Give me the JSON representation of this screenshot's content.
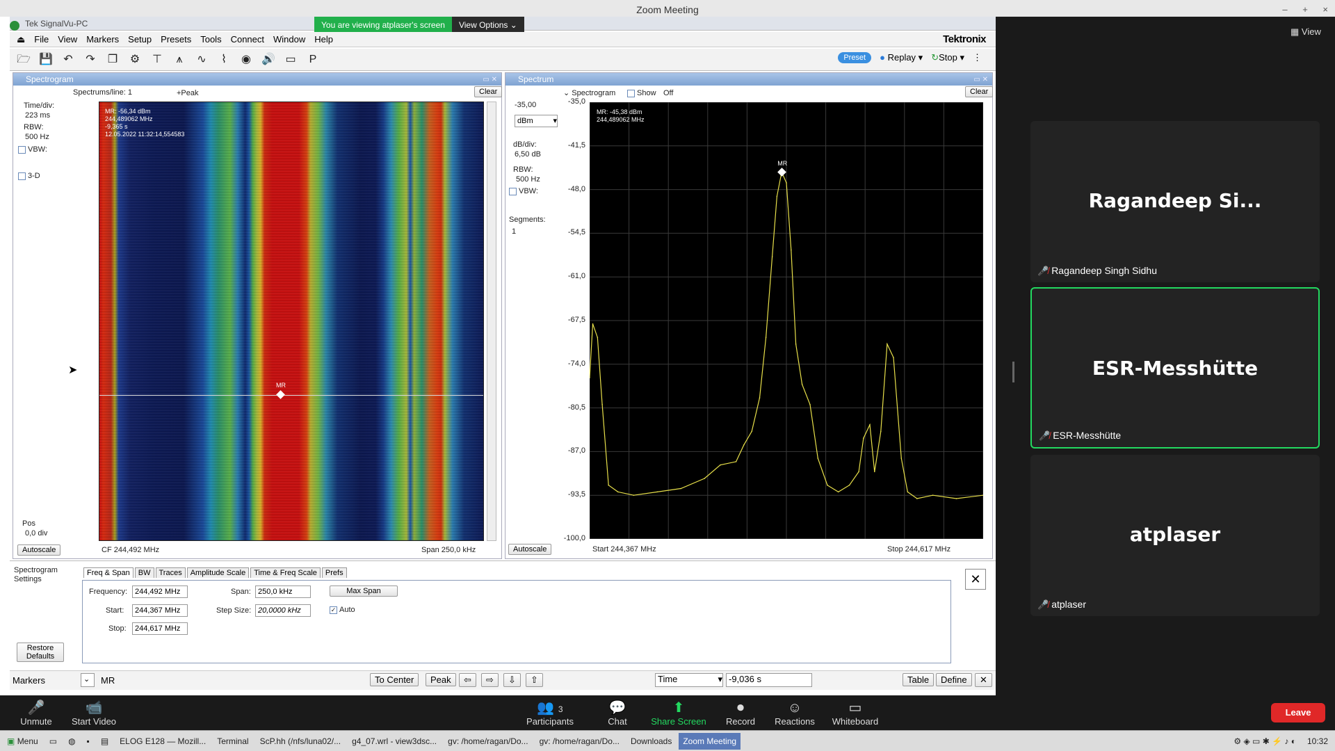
{
  "zoom": {
    "window_title": "Zoom Meeting",
    "win_controls": [
      "–",
      "+",
      "×"
    ],
    "view_label": "View",
    "participants": [
      {
        "display": "Ragandeep Si...",
        "full": "Ragandeep Singh Sidhu",
        "active": false
      },
      {
        "display": "ESR-Messhütte",
        "full": "ESR-Messhütte",
        "active": true
      },
      {
        "display": "atplaser",
        "full": "atplaser",
        "active": false
      }
    ],
    "controls": {
      "unmute": "Unmute",
      "start_video": "Start Video",
      "participants": "Participants",
      "participants_count": "3",
      "chat": "Chat",
      "share_screen": "Share Screen",
      "record": "Record",
      "reactions": "Reactions",
      "whiteboard": "Whiteboard",
      "leave": "Leave"
    }
  },
  "share_banner": {
    "text": "You are viewing atplaser's screen",
    "view_options": "View Options"
  },
  "signalvu": {
    "title": "Tek SignalVu-PC",
    "brand": "Tektronix",
    "menu": [
      "File",
      "View",
      "Markers",
      "Setup",
      "Presets",
      "Tools",
      "Connect",
      "Window",
      "Help"
    ],
    "toolbar_right": {
      "preset": "Preset",
      "replay": "Replay",
      "stop": "Stop"
    }
  },
  "spectrogram": {
    "title": "Spectrogram",
    "spectrums_per_line_label": "Spectrums/line:",
    "spectrums_per_line_value": "1",
    "detector": "+Peak",
    "clear": "Clear",
    "time_div_label": "Time/div:",
    "time_div_value": "223 ms",
    "rbw_label": "RBW:",
    "rbw_value": "500 Hz",
    "vbw_label": "VBW:",
    "threed_label": "3-D",
    "pos_label": "Pos",
    "pos_value": "0,0 div",
    "autoscale": "Autoscale",
    "marker_line1": "MR: -56,34 dBm",
    "marker_line2": "244,489062 MHz",
    "marker_line3": "-9,365 s",
    "marker_line4": "12.05.2022 11:32:14,554583",
    "marker_tag": "MR",
    "cf": "CF  244,492 MHz",
    "span": "Span  250,0 kHz"
  },
  "spectrum": {
    "title": "Spectrum",
    "spectrogram_label": "Spectrogram",
    "show_label": "Show",
    "off_label": "Off",
    "clear": "Clear",
    "ref_level": "-35,00",
    "unit": "dBm",
    "db_div_label": "dB/div:",
    "db_div_value": "6,50 dB",
    "rbw_label": "RBW:",
    "rbw_value": "500 Hz",
    "vbw_label": "VBW:",
    "segments_label": "Segments:",
    "segments_value": "1",
    "autoscale": "Autoscale",
    "marker_line1": "MR: -45,38 dBm",
    "marker_line2": "244,489062 MHz",
    "marker_tag": "MR",
    "start": "Start   244,367 MHz",
    "stop": "Stop  244,617 MHz"
  },
  "chart_data": {
    "type": "line",
    "title": "",
    "xlabel": "",
    "ylabel": "",
    "xlim": [
      244.367,
      244.617
    ],
    "ylim": [
      -100.0,
      -35.0
    ],
    "y_ticks": [
      "-35,0",
      "-41,5",
      "-48,0",
      "-54,5",
      "-61,0",
      "-67,5",
      "-74,0",
      "-80,5",
      "-87,0",
      "-93,5",
      "-100,0"
    ],
    "series": [
      {
        "x": [
          244.367,
          244.369,
          244.372,
          244.375,
          244.379,
          244.385,
          244.395,
          244.41,
          244.425,
          244.44,
          244.45,
          244.46,
          244.465,
          244.47,
          244.475,
          244.479,
          244.483,
          244.486,
          244.489,
          244.492,
          244.495,
          244.498,
          244.502,
          244.507,
          244.512,
          244.518,
          244.525,
          244.532,
          244.538,
          244.541,
          244.545,
          244.548,
          244.552,
          244.556,
          244.56,
          244.565,
          244.569,
          244.575,
          244.585,
          244.6,
          244.617
        ],
        "y": [
          -76.0,
          -68.0,
          -70.0,
          -80.0,
          -92.0,
          -93.0,
          -93.5,
          -93.0,
          -92.5,
          -91.0,
          -89.0,
          -88.5,
          -86.0,
          -84.0,
          -79.0,
          -70.0,
          -58.0,
          -49.0,
          -45.4,
          -47.0,
          -57.0,
          -71.0,
          -77.0,
          -80.0,
          -88.0,
          -92.0,
          -93.0,
          -92.0,
          -90.0,
          -85.0,
          -83.0,
          -90.0,
          -84.0,
          -71.0,
          -73.0,
          -88.0,
          -93.0,
          -94.0,
          -93.5,
          -94.0,
          -93.5
        ]
      }
    ]
  },
  "settings": {
    "title": "Spectrogram Settings",
    "tabs": [
      "Freq & Span",
      "BW",
      "Traces",
      "Amplitude Scale",
      "Time & Freq Scale",
      "Prefs"
    ],
    "frequency_label": "Frequency:",
    "frequency_value": "244,492 MHz",
    "start_label": "Start:",
    "start_value": "244,367 MHz",
    "stop_label": "Stop:",
    "stop_value": "244,617 MHz",
    "span_label": "Span:",
    "span_value": "250,0 kHz",
    "step_label": "Step Size:",
    "step_value": "20,0000 kHz",
    "auto_label": "Auto",
    "max_span": "Max Span",
    "restore": "Restore Defaults"
  },
  "markers_bar": {
    "label": "Markers",
    "marker_value": "MR",
    "to_center": "To Center",
    "peak": "Peak",
    "time_label": "Time",
    "time_value": "-9,036 s",
    "table": "Table",
    "define": "Define"
  },
  "taskbar": {
    "menu": "Menu",
    "tasks": [
      "ELOG E128 — Mozill...",
      "Terminal",
      "ScP.hh (/nfs/luna02/...",
      "g4_07.wrl - view3dsc...",
      "gv: /home/ragan/Do...",
      "gv: /home/ragan/Do...",
      "Downloads",
      "Zoom Meeting"
    ],
    "clock": "10:32"
  }
}
